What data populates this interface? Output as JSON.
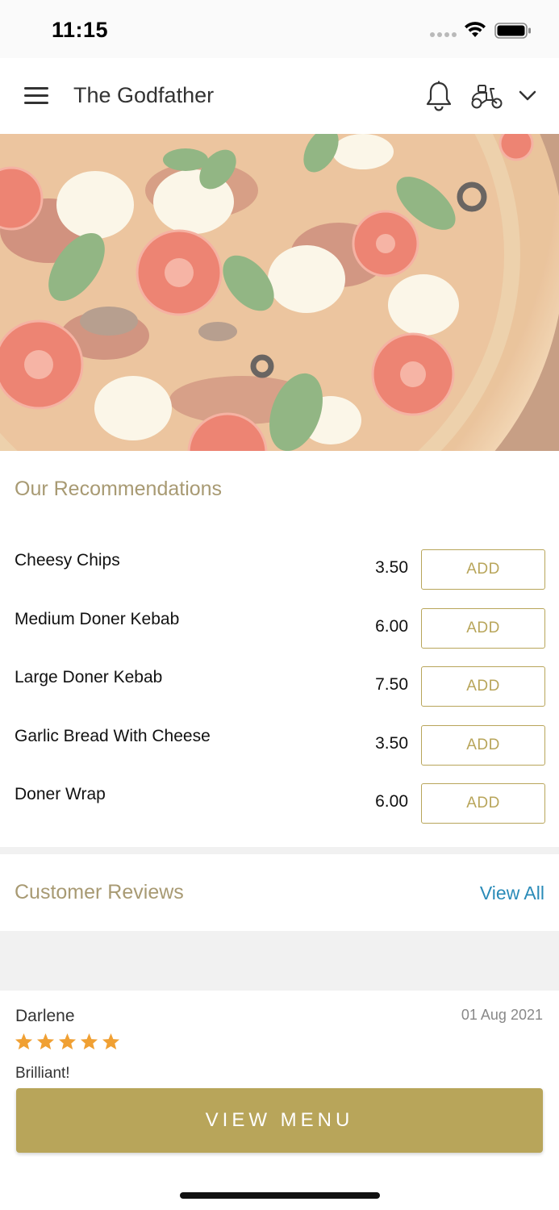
{
  "status_bar": {
    "time": "11:15"
  },
  "header": {
    "title": "The Godfather",
    "icons": [
      "menu-icon",
      "bell-icon",
      "scooter-icon",
      "chevron-down-icon"
    ]
  },
  "recommendations": {
    "title": "Our Recommendations",
    "items": [
      {
        "name": "Cheesy Chips",
        "price": "3.50",
        "button": "ADD"
      },
      {
        "name": "Medium Doner Kebab",
        "price": "6.00",
        "button": "ADD"
      },
      {
        "name": "Large Doner Kebab",
        "price": "7.50",
        "button": "ADD"
      },
      {
        "name": "Garlic Bread With Cheese",
        "price": "3.50",
        "button": "ADD"
      },
      {
        "name": "Doner Wrap",
        "price": "6.00",
        "button": "ADD"
      }
    ]
  },
  "reviews": {
    "title": "Customer Reviews",
    "view_all": "View All",
    "latest": {
      "name": "Darlene",
      "date": "01 Aug 2021",
      "rating": 5,
      "text": "Brilliant!"
    }
  },
  "cta": {
    "label": "VIEW MENU"
  },
  "colors": {
    "accent": "#b8a55a",
    "section_title": "#a89a73",
    "link": "#2a8bb8",
    "star": "#f0a033"
  }
}
